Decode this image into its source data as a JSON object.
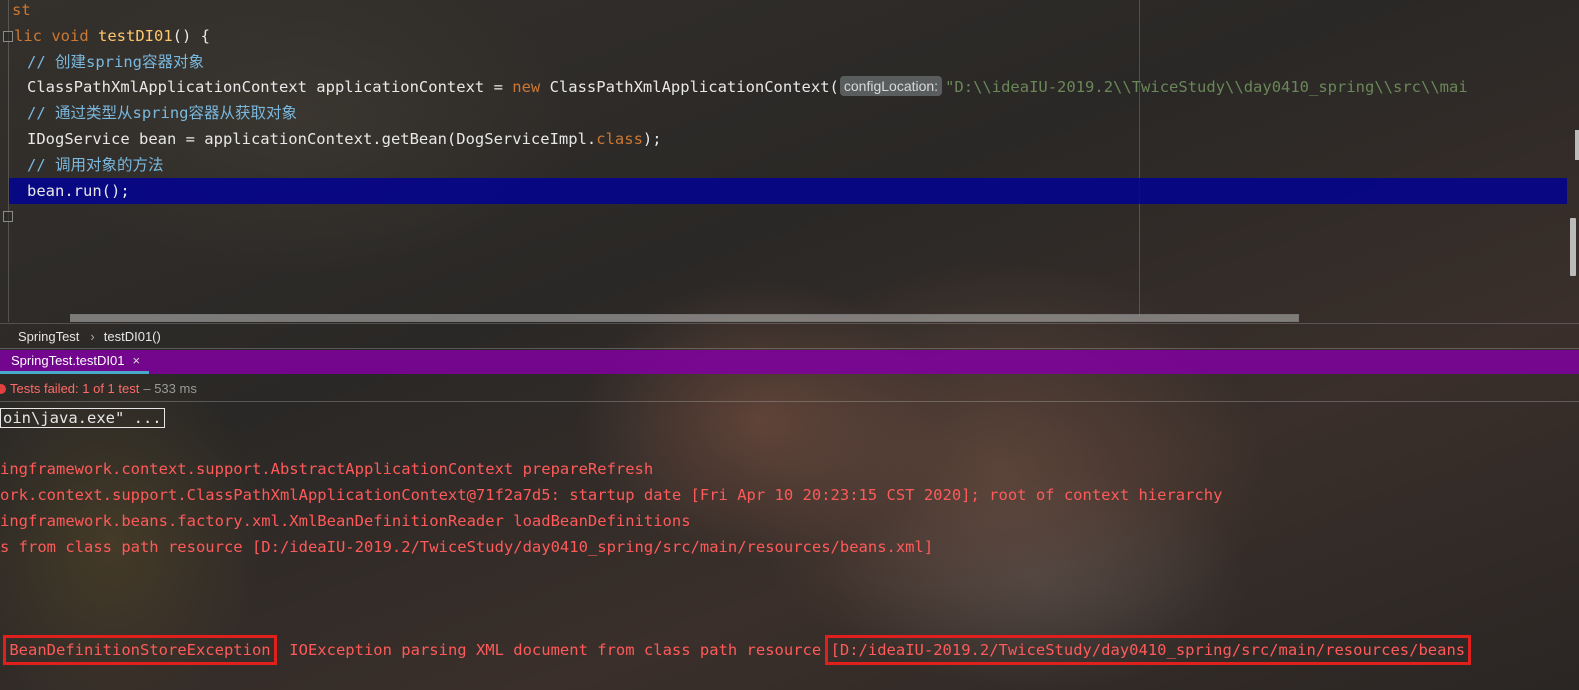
{
  "editor": {
    "lines": [
      {
        "a": "st"
      },
      {
        "kw1": "lic void ",
        "fn": "testDI01",
        "rest": "() {"
      },
      {
        "comment": "// 创建spring容器对象"
      },
      {
        "pre": "ClassPathXmlApplicationContext applicationContext = ",
        "kw": "new",
        "post": " ClassPathXmlApplicationContext(",
        "hint": "configLocation:",
        "str": "\"D:\\\\ideaIU-2019.2\\\\TwiceStudy\\\\day0410_spring\\\\src\\\\mai"
      },
      {
        "comment": "// 通过类型从spring容器从获取对象"
      },
      {
        "pre": "IDogService bean = applicationContext.getBean(DogServiceImpl.",
        "kw": "class",
        "post": ");"
      },
      {
        "comment": "// 调用对象的方法"
      },
      {
        "pre": "bean.run();"
      }
    ]
  },
  "breadcrumb": {
    "class_name": "SpringTest",
    "method": "testDI01()"
  },
  "run_tab": {
    "label": "SpringTest.testDI01",
    "close": "×"
  },
  "status": {
    "failed": "Tests failed: 1 of 1 test",
    "time": "– 533 ms"
  },
  "console": {
    "cmd": "oin\\java.exe\" ...",
    "lines": [
      "ingframework.context.support.AbstractApplicationContext prepareRefresh",
      "ork.context.support.ClassPathXmlApplicationContext@71f2a7d5: startup date [Fri Apr 10 20:23:15 CST 2020]; root of context hierarchy",
      "ingframework.beans.factory.xml.XmlBeanDefinitionReader loadBeanDefinitions",
      "s from class path resource [D:/ideaIU-2019.2/TwiceStudy/day0410_spring/src/main/resources/beans.xml]"
    ],
    "error": {
      "prefix": ".",
      "exception": "BeanDefinitionStoreException",
      "middle": ": IOException parsing XML document from class path resource ",
      "path": "[D:/ideaIU-2019.2/TwiceStudy/day0410_spring/src/main/resources/beans"
    }
  }
}
